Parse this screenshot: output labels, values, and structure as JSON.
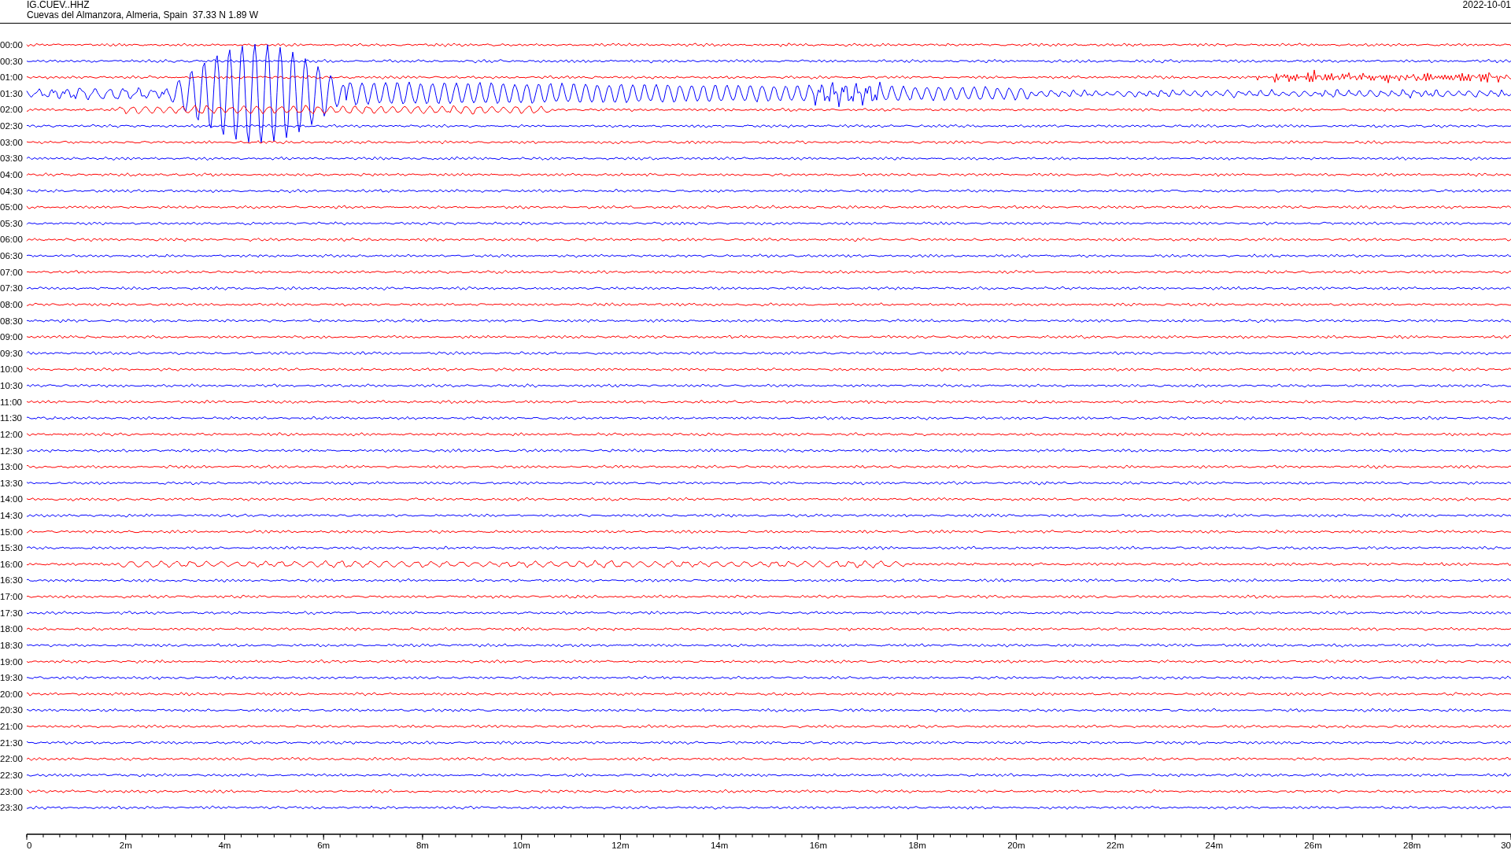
{
  "header": {
    "station": "IG.CUEV..HHZ",
    "location": "Cuevas del Almanzora, Almeria, Spain  37.33 N 1.89 W",
    "date": "2022-10-01"
  },
  "rows": [
    {
      "label": "00:00",
      "color": "#ff0000"
    },
    {
      "label": "00:30",
      "color": "#0000ff"
    },
    {
      "label": "01:00",
      "color": "#ff0000"
    },
    {
      "label": "01:30",
      "color": "#0000ff"
    },
    {
      "label": "02:00",
      "color": "#ff0000"
    },
    {
      "label": "02:30",
      "color": "#0000ff"
    },
    {
      "label": "03:00",
      "color": "#ff0000"
    },
    {
      "label": "03:30",
      "color": "#0000ff"
    },
    {
      "label": "04:00",
      "color": "#ff0000"
    },
    {
      "label": "04:30",
      "color": "#0000ff"
    },
    {
      "label": "05:00",
      "color": "#ff0000"
    },
    {
      "label": "05:30",
      "color": "#0000ff"
    },
    {
      "label": "06:00",
      "color": "#ff0000"
    },
    {
      "label": "06:30",
      "color": "#0000ff"
    },
    {
      "label": "07:00",
      "color": "#ff0000"
    },
    {
      "label": "07:30",
      "color": "#0000ff"
    },
    {
      "label": "08:00",
      "color": "#ff0000"
    },
    {
      "label": "08:30",
      "color": "#0000ff"
    },
    {
      "label": "09:00",
      "color": "#ff0000"
    },
    {
      "label": "09:30",
      "color": "#0000ff"
    },
    {
      "label": "10:00",
      "color": "#ff0000"
    },
    {
      "label": "10:30",
      "color": "#0000ff"
    },
    {
      "label": "11:00",
      "color": "#ff0000"
    },
    {
      "label": "11:30",
      "color": "#0000ff"
    },
    {
      "label": "12:00",
      "color": "#ff0000"
    },
    {
      "label": "12:30",
      "color": "#0000ff"
    },
    {
      "label": "13:00",
      "color": "#ff0000"
    },
    {
      "label": "13:30",
      "color": "#0000ff"
    },
    {
      "label": "14:00",
      "color": "#ff0000"
    },
    {
      "label": "14:30",
      "color": "#0000ff"
    },
    {
      "label": "15:00",
      "color": "#ff0000"
    },
    {
      "label": "15:30",
      "color": "#0000ff"
    },
    {
      "label": "16:00",
      "color": "#ff0000"
    },
    {
      "label": "16:30",
      "color": "#0000ff"
    },
    {
      "label": "17:00",
      "color": "#ff0000"
    },
    {
      "label": "17:30",
      "color": "#0000ff"
    },
    {
      "label": "18:00",
      "color": "#ff0000"
    },
    {
      "label": "18:30",
      "color": "#0000ff"
    },
    {
      "label": "19:00",
      "color": "#ff0000"
    },
    {
      "label": "19:30",
      "color": "#0000ff"
    },
    {
      "label": "20:00",
      "color": "#ff0000"
    },
    {
      "label": "20:30",
      "color": "#0000ff"
    },
    {
      "label": "21:00",
      "color": "#ff0000"
    },
    {
      "label": "21:30",
      "color": "#0000ff"
    },
    {
      "label": "22:00",
      "color": "#ff0000"
    },
    {
      "label": "22:30",
      "color": "#0000ff"
    },
    {
      "label": "23:00",
      "color": "#ff0000"
    },
    {
      "label": "23:30",
      "color": "#0000ff"
    }
  ],
  "x_axis": {
    "ticks": [
      "0",
      "2m",
      "4m",
      "6m",
      "8m",
      "10m",
      "12m",
      "14m",
      "16m",
      "18m",
      "20m",
      "22m",
      "24m",
      "26m",
      "28m",
      "30"
    ]
  }
}
